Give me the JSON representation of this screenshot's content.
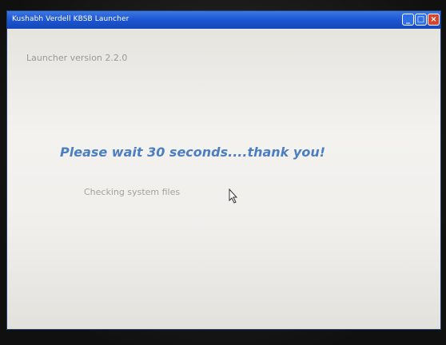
{
  "window": {
    "title": "Kushabh Verdell KBSB Launcher",
    "controls": {
      "minimize_icon": "minimize-icon",
      "maximize_icon": "maximize-icon",
      "close_icon": "close-icon"
    }
  },
  "content": {
    "version_text": "Launcher version 2.2.0",
    "wait_message": "Please wait 30 seconds....thank you!",
    "status_text": "Checking system files"
  },
  "colors": {
    "titlebar": "#1f58d4",
    "wait_message": "#4d7fc0",
    "close_button": "#d6452f"
  }
}
